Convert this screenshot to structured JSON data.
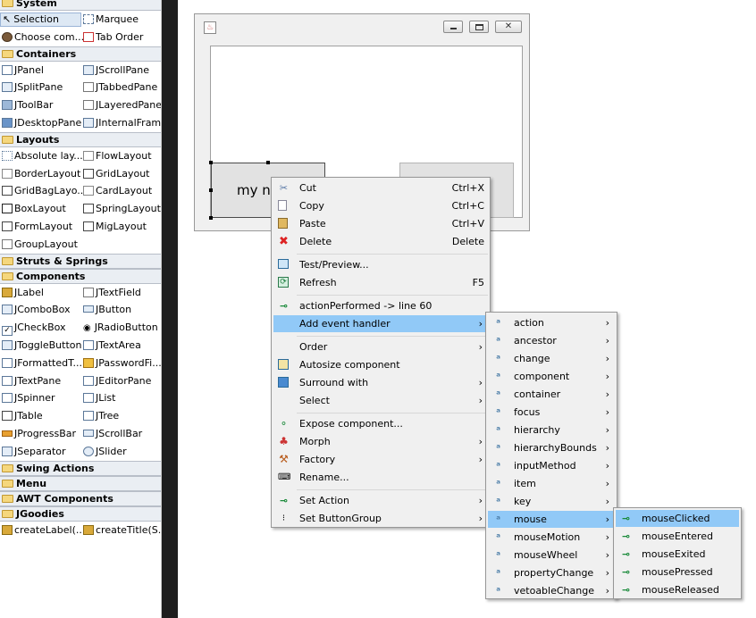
{
  "palette": {
    "categories": {
      "system": "System",
      "containers": "Containers",
      "layouts": "Layouts",
      "struts": "Struts & Springs",
      "components": "Components",
      "swing_actions": "Swing Actions",
      "menu": "Menu",
      "awt": "AWT Components",
      "jgoodies": "JGoodies"
    },
    "system": [
      "Selection",
      "Marquee",
      "Choose com...",
      "Tab Order"
    ],
    "containers": [
      "JPanel",
      "JScrollPane",
      "JSplitPane",
      "JTabbedPane",
      "JToolBar",
      "JLayeredPane",
      "JDesktopPane",
      "JInternalFrame"
    ],
    "layouts": [
      "Absolute lay...",
      "FlowLayout",
      "BorderLayout",
      "GridLayout",
      "GridBagLayo...",
      "CardLayout",
      "BoxLayout",
      "SpringLayout",
      "FormLayout",
      "MigLayout",
      "GroupLayout"
    ],
    "components": [
      "JLabel",
      "JTextField",
      "JComboBox",
      "JButton",
      "JCheckBox",
      "JRadioButton",
      "JToggleButton",
      "JTextArea",
      "JFormattedT...",
      "JPasswordFi...",
      "JTextPane",
      "JEditorPane",
      "JSpinner",
      "JList",
      "JTable",
      "JTree",
      "JProgressBar",
      "JScrollBar",
      "JSeparator",
      "JSlider"
    ],
    "jgoodies": [
      "createLabel(...",
      "createTitle(S..."
    ]
  },
  "designer": {
    "button_text": "my n"
  },
  "context_menu": {
    "cut": "Cut",
    "cut_sc": "Ctrl+X",
    "copy": "Copy",
    "copy_sc": "Ctrl+C",
    "paste": "Paste",
    "paste_sc": "Ctrl+V",
    "delete": "Delete",
    "delete_sc": "Delete",
    "test_preview": "Test/Preview...",
    "refresh": "Refresh",
    "refresh_sc": "F5",
    "action_performed": "actionPerformed -> line 60",
    "add_event_handler": "Add event handler",
    "order": "Order",
    "autosize": "Autosize component",
    "surround_with": "Surround with",
    "select": "Select",
    "expose": "Expose component...",
    "morph": "Morph",
    "factory": "Factory",
    "rename": "Rename...",
    "set_action": "Set Action",
    "set_button_group": "Set ButtonGroup"
  },
  "event_menu": [
    "action",
    "ancestor",
    "change",
    "component",
    "container",
    "focus",
    "hierarchy",
    "hierarchyBounds",
    "inputMethod",
    "item",
    "key",
    "mouse",
    "mouseMotion",
    "mouseWheel",
    "propertyChange",
    "vetoableChange"
  ],
  "mouse_menu": [
    "mouseClicked",
    "mouseEntered",
    "mouseExited",
    "mousePressed",
    "mouseReleased"
  ],
  "colors": {
    "menu_highlight": "#91c9f7",
    "palette_category": "#eaeef3",
    "dark_divider": "#1e1e1e"
  }
}
